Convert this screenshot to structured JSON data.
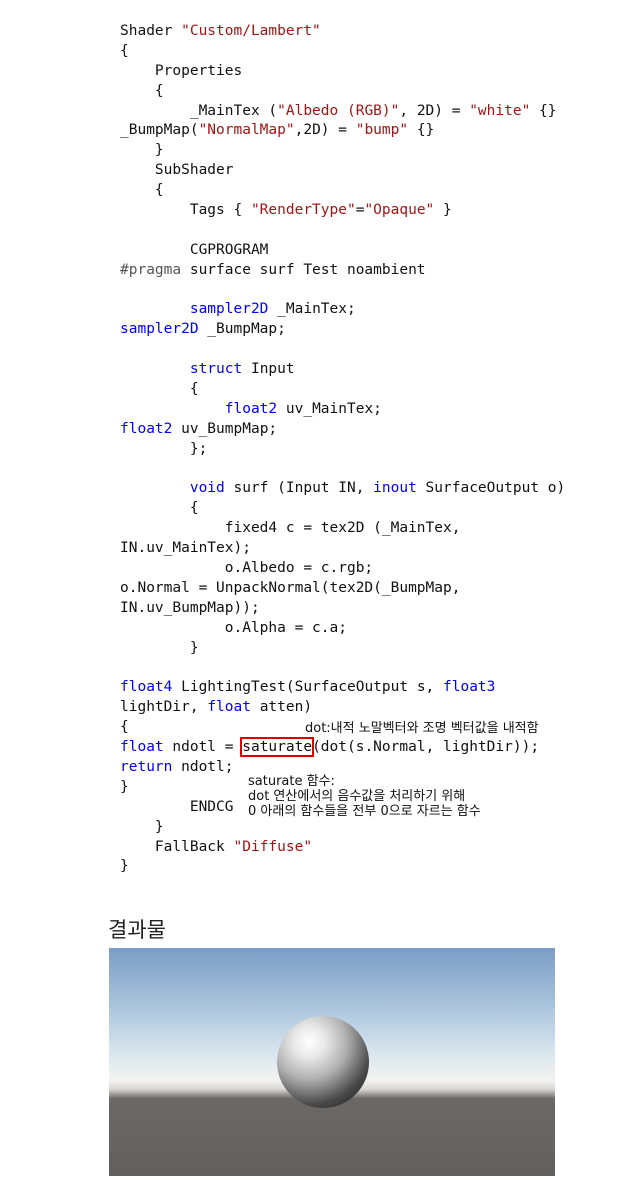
{
  "code_lines": [
    [
      {
        "t": "Shader "
      },
      {
        "t": "\"Custom/Lambert\"",
        "c": "s"
      }
    ],
    [
      {
        "t": "{"
      }
    ],
    [
      {
        "t": "    Properties"
      }
    ],
    [
      {
        "t": "    {"
      }
    ],
    [
      {
        "t": "        _MainTex ("
      },
      {
        "t": "\"Albedo (RGB)\"",
        "c": "s"
      },
      {
        "t": ", 2D) = "
      },
      {
        "t": "\"white\"",
        "c": "s"
      },
      {
        "t": " {}"
      }
    ],
    [
      {
        "t": "_BumpMap("
      },
      {
        "t": "\"NormalMap\"",
        "c": "s"
      },
      {
        "t": ",2D) = "
      },
      {
        "t": "\"bump\"",
        "c": "s"
      },
      {
        "t": " {}"
      }
    ],
    [
      {
        "t": "    }"
      }
    ],
    [
      {
        "t": "    SubShader"
      }
    ],
    [
      {
        "t": "    {"
      }
    ],
    [
      {
        "t": "        Tags { "
      },
      {
        "t": "\"RenderType\"",
        "c": "s"
      },
      {
        "t": "="
      },
      {
        "t": "\"Opaque\"",
        "c": "s"
      },
      {
        "t": " }"
      }
    ],
    [
      {
        "t": ""
      }
    ],
    [
      {
        "t": "        CGPROGRAM"
      }
    ],
    [
      {
        "t": "#pragma",
        "c": "p"
      },
      {
        "t": " surface surf Test noambient"
      }
    ],
    [
      {
        "t": ""
      }
    ],
    [
      {
        "t": "        "
      },
      {
        "t": "sampler2D",
        "c": "k"
      },
      {
        "t": " _MainTex;"
      }
    ],
    [
      {
        "t": "sampler2D",
        "c": "k"
      },
      {
        "t": " _BumpMap;"
      }
    ],
    [
      {
        "t": ""
      }
    ],
    [
      {
        "t": "        "
      },
      {
        "t": "struct",
        "c": "k"
      },
      {
        "t": " Input"
      }
    ],
    [
      {
        "t": "        {"
      }
    ],
    [
      {
        "t": "            "
      },
      {
        "t": "float2",
        "c": "k"
      },
      {
        "t": " uv_MainTex;"
      }
    ],
    [
      {
        "t": "float2",
        "c": "k"
      },
      {
        "t": " uv_BumpMap;"
      }
    ],
    [
      {
        "t": "        };"
      }
    ],
    [
      {
        "t": ""
      }
    ],
    [
      {
        "t": "        "
      },
      {
        "t": "void",
        "c": "k"
      },
      {
        "t": " surf (Input IN, "
      },
      {
        "t": "inout",
        "c": "k"
      },
      {
        "t": " SurfaceOutput o)"
      }
    ],
    [
      {
        "t": "        {"
      }
    ],
    [
      {
        "t": "            fixed4 c = tex2D (_MainTex,"
      }
    ],
    [
      {
        "t": "IN.uv_MainTex);"
      }
    ],
    [
      {
        "t": "            o.Albedo = c.rgb;"
      }
    ],
    [
      {
        "t": "o.Normal = UnpackNormal(tex2D(_BumpMap,"
      }
    ],
    [
      {
        "t": "IN.uv_BumpMap));"
      }
    ],
    [
      {
        "t": "            o.Alpha = c.a;"
      }
    ],
    [
      {
        "t": "        }"
      }
    ],
    [
      {
        "t": ""
      }
    ],
    [
      {
        "t": "float4",
        "c": "k"
      },
      {
        "t": " LightingTest(SurfaceOutput s, "
      },
      {
        "t": "float3",
        "c": "k"
      }
    ],
    [
      {
        "t": "lightDir, "
      },
      {
        "t": "float",
        "c": "k"
      },
      {
        "t": " atten)"
      }
    ],
    [
      {
        "t": "{"
      }
    ],
    [
      {
        "t": "float",
        "c": "k"
      },
      {
        "t": " ndotl = "
      },
      {
        "t": "saturate",
        "h": true
      },
      {
        "t": "(dot(s.Normal, lightDir));"
      }
    ],
    [
      {
        "t": "return",
        "c": "k"
      },
      {
        "t": " ndotl;"
      }
    ],
    [
      {
        "t": "}"
      }
    ],
    [
      {
        "t": "        ENDCG"
      }
    ],
    [
      {
        "t": "    }"
      }
    ],
    [
      {
        "t": "    FallBack "
      },
      {
        "t": "\"Diffuse\"",
        "c": "s"
      }
    ],
    [
      {
        "t": "}"
      }
    ]
  ],
  "annotations": {
    "dot_note": "dot:내적 노말벡터와 조명 벡터값을 내적함",
    "saturate_note": "saturate 함수:\ndot 연산에서의 음수값을 처리하기 위해\n0 아래의 함수들을 전부 0으로 자르는 함수"
  },
  "result": {
    "title": "결과물"
  },
  "colors": {
    "string": "#a31515",
    "keyword": "#0000ff",
    "highlight_box": "#e00000"
  }
}
